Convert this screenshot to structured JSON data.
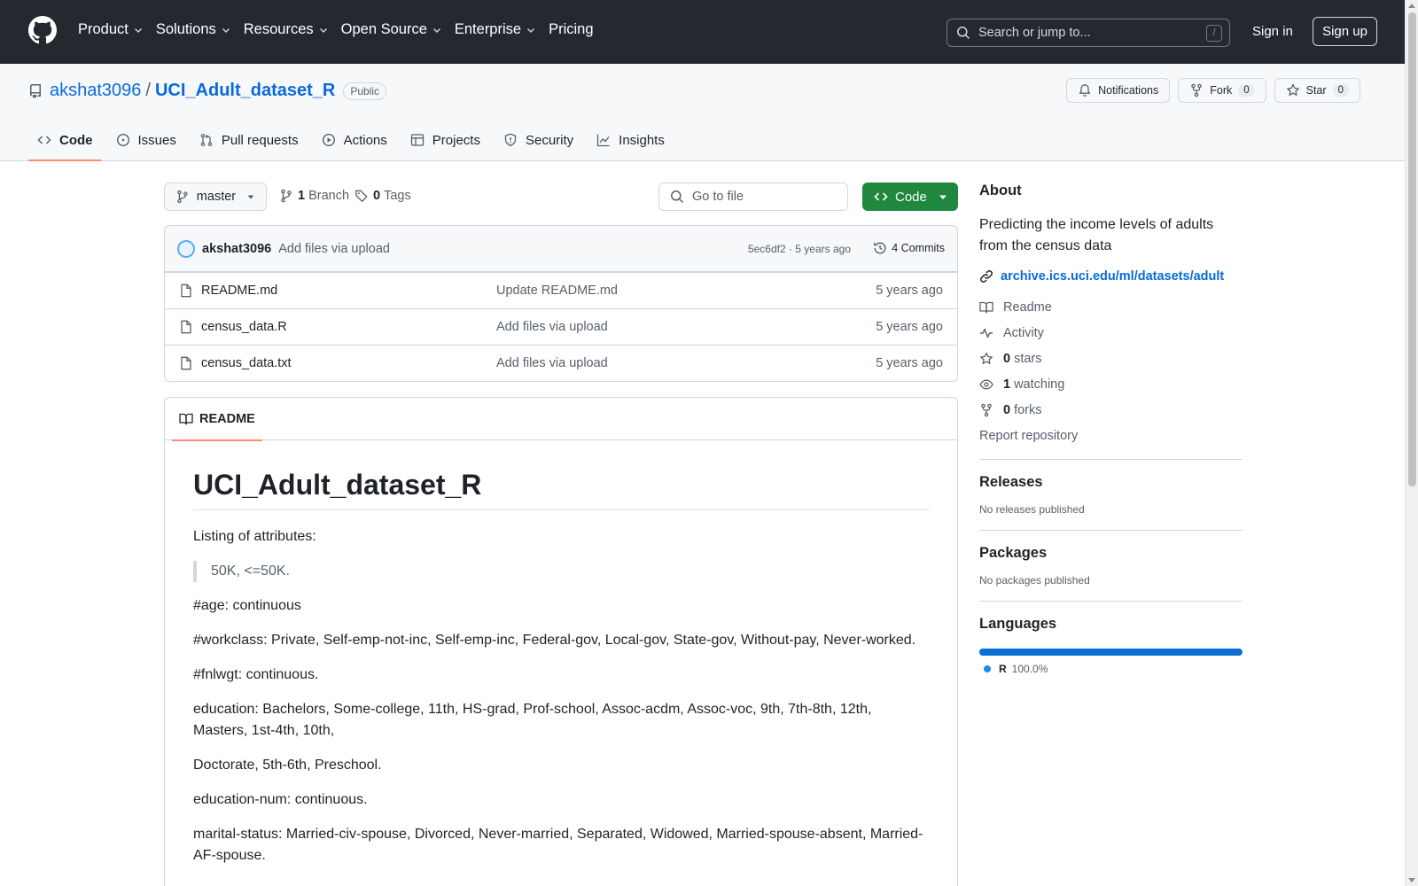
{
  "colors": {
    "header_bg": "#24292f",
    "link_blue": "#0969da",
    "code_button_green": "#1f883d",
    "active_tab_underline": "#fd8c73",
    "language_r": "#198ce7"
  },
  "header": {
    "nav": [
      {
        "label": "Product",
        "has_dropdown": true
      },
      {
        "label": "Solutions",
        "has_dropdown": true
      },
      {
        "label": "Resources",
        "has_dropdown": true
      },
      {
        "label": "Open Source",
        "has_dropdown": true
      },
      {
        "label": "Enterprise",
        "has_dropdown": true
      },
      {
        "label": "Pricing",
        "has_dropdown": false
      }
    ],
    "search_placeholder": "Search or jump to...",
    "search_shortcut": "/",
    "sign_in": "Sign in",
    "sign_up": "Sign up"
  },
  "repo": {
    "owner": "akshat3096",
    "separator": "/",
    "name": "UCI_Adult_dataset_R",
    "visibility": "Public",
    "notifications_label": "Notifications",
    "fork_label": "Fork",
    "fork_count": "0",
    "star_label": "Star",
    "star_count": "0"
  },
  "tabs": [
    {
      "label": "Code",
      "icon": "code-icon",
      "active": true
    },
    {
      "label": "Issues",
      "icon": "issue-icon",
      "active": false
    },
    {
      "label": "Pull requests",
      "icon": "pull-request-icon",
      "active": false
    },
    {
      "label": "Actions",
      "icon": "play-icon",
      "active": false
    },
    {
      "label": "Projects",
      "icon": "table-icon",
      "active": false
    },
    {
      "label": "Security",
      "icon": "shield-icon",
      "active": false
    },
    {
      "label": "Insights",
      "icon": "graph-icon",
      "active": false
    }
  ],
  "toolbar": {
    "branch": "master",
    "branches_count": "1",
    "branches_label": "Branch",
    "tags_count": "0",
    "tags_label": "Tags",
    "goto_placeholder": "Go to file",
    "code_button": "Code"
  },
  "latest_commit": {
    "author": "akshat3096",
    "message": "Add files via upload",
    "hash_and_age": "5ec6df2 · 5 years ago",
    "commits_label": "4 Commits"
  },
  "files": [
    {
      "name": "README.md",
      "message": "Update README.md",
      "age": "5 years ago"
    },
    {
      "name": "census_data.R",
      "message": "Add files via upload",
      "age": "5 years ago"
    },
    {
      "name": "census_data.txt",
      "message": "Add files via upload",
      "age": "5 years ago"
    }
  ],
  "readme": {
    "tab_label": "README",
    "title": "UCI_Adult_dataset_R",
    "intro": "Listing of attributes:",
    "quote": "50K, <=50K.",
    "lines": [
      "#age: continuous",
      "#workclass: Private, Self-emp-not-inc, Self-emp-inc, Federal-gov, Local-gov, State-gov, Without-pay, Never-worked.",
      "#fnlwgt: continuous.",
      "education: Bachelors, Some-college, 11th, HS-grad, Prof-school, Assoc-acdm, Assoc-voc, 9th, 7th-8th, 12th, Masters, 1st-4th, 10th,",
      "Doctorate, 5th-6th, Preschool.",
      "education-num: continuous.",
      "marital-status: Married-civ-spouse, Divorced, Never-married, Separated, Widowed, Married-spouse-absent, Married-AF-spouse."
    ]
  },
  "sidebar": {
    "about_title": "About",
    "description": "Predicting the income levels of adults from the census data",
    "website": "archive.ics.uci.edu/ml/datasets/adult",
    "readme_label": "Readme",
    "activity_label": "Activity",
    "stars_count": "0",
    "stars_label": "stars",
    "watching_count": "1",
    "watching_label": "watching",
    "forks_count": "0",
    "forks_label": "forks",
    "report_label": "Report repository",
    "releases_title": "Releases",
    "releases_empty": "No releases published",
    "packages_title": "Packages",
    "packages_empty": "No packages published",
    "languages_title": "Languages",
    "languages": [
      {
        "name": "R",
        "percent": "100.0%",
        "share": 100
      }
    ]
  }
}
